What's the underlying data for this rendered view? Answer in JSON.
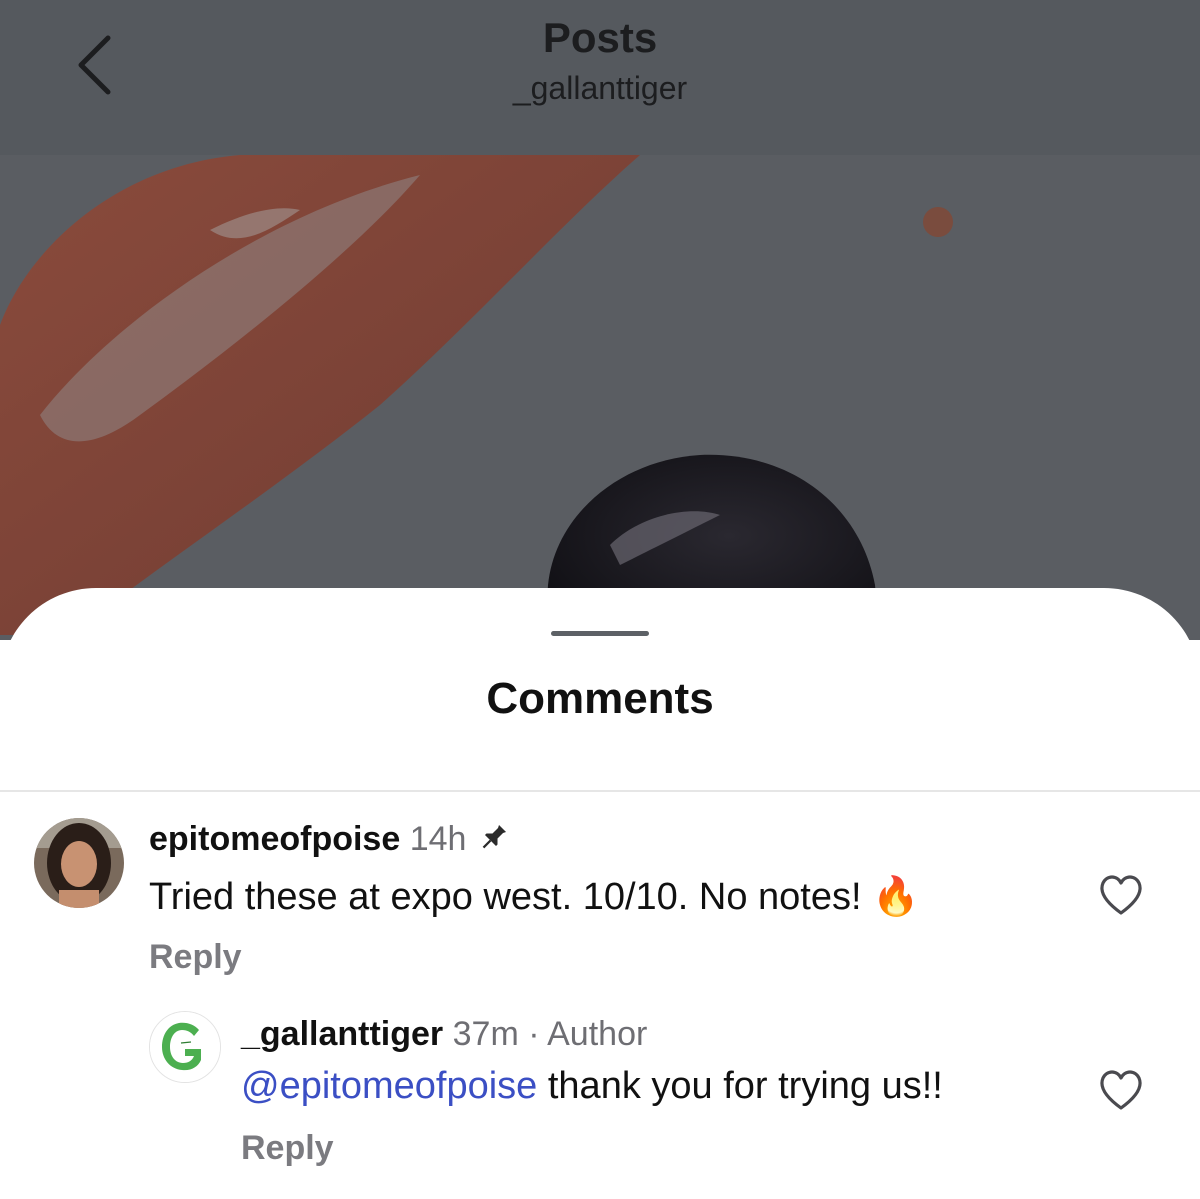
{
  "nav": {
    "title": "Posts",
    "subtitle": "_gallanttiger",
    "back_icon": "chevron-left-icon"
  },
  "post": {
    "image": "sauce-swatches-photo"
  },
  "comments_sheet": {
    "title": "Comments",
    "comments": [
      {
        "username": "epitomeofpoise",
        "time": "14h",
        "pinned_icon": "pin-icon",
        "text": "Tried these at expo west. 10/10. No notes! ",
        "emoji": "🔥",
        "reply_label": "Reply",
        "like_icon": "heart-outline-icon"
      },
      {
        "username": "_gallanttiger",
        "time": "37m",
        "separator": "·",
        "badge": "Author",
        "mention": "@epitomeofpoise",
        "text": " thank you for trying us!!",
        "reply_label": "Reply",
        "like_icon": "heart-outline-icon"
      }
    ]
  },
  "colors": {
    "backdrop": "#5a5d62",
    "mention": "#3b4fc4",
    "muted_text": "#6e6e73",
    "brand_green": "#4caf50"
  }
}
